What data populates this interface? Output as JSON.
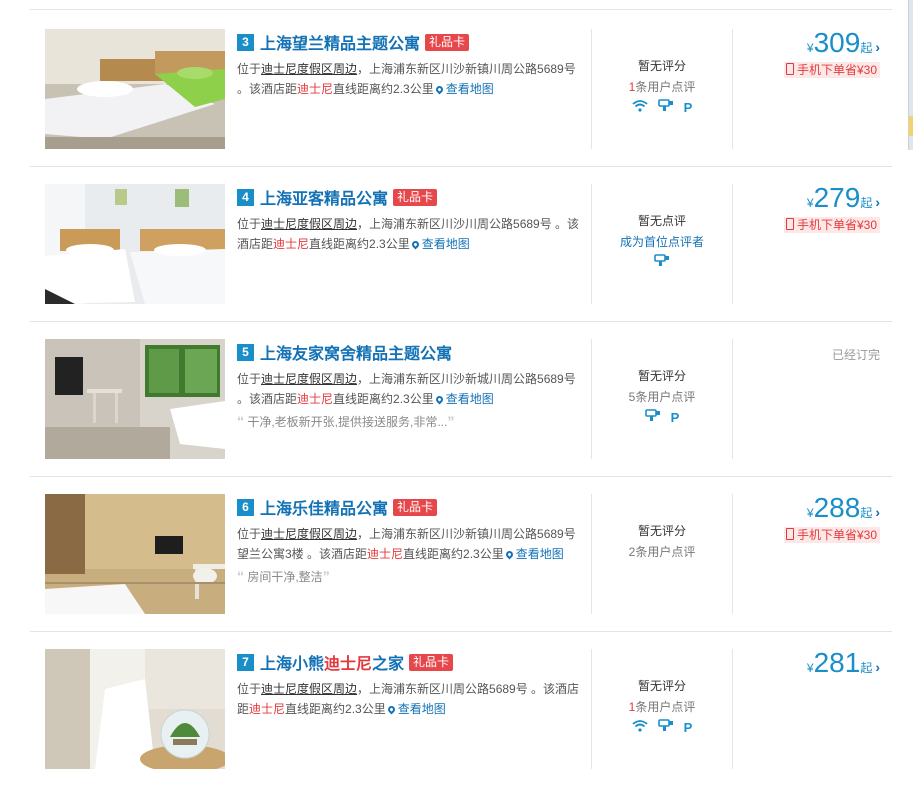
{
  "hotels": [
    {
      "rank": "3",
      "name": "上海望兰精品主题公寓",
      "gift": "礼品卡",
      "addr_pre": "位于",
      "area": "迪士尼度假区周边",
      "addr_mid": "，上海浦东新区川沙新镇川周公路5689号 。该酒店距",
      "landmark": "迪士尼",
      "addr_post": "直线距离约2.3公里",
      "map": "查看地图",
      "score": "暂无评分",
      "count_num": "1",
      "count_text": "条用户点评",
      "price_yen": "¥",
      "price": "309",
      "price_suffix": "起",
      "mobile": "手机下单省¥30",
      "facilities": [
        "wifi-icon",
        "hairdryer-icon",
        "parking-icon"
      ]
    },
    {
      "rank": "4",
      "name": "上海亚客精品公寓",
      "gift": "礼品卡",
      "addr_pre": "位于",
      "area": "迪士尼度假区周边",
      "addr_mid": "，上海浦东新区川沙川周公路5689号 。该酒店距",
      "landmark": "迪士尼",
      "addr_post": "直线距离约2.3公里",
      "map": "查看地图",
      "score": "暂无点评",
      "first_review": "成为首位点评者",
      "price_yen": "¥",
      "price": "279",
      "price_suffix": "起",
      "mobile": "手机下单省¥30",
      "facilities": [
        "hairdryer-icon"
      ]
    },
    {
      "rank": "5",
      "name": "上海友家窝舍精品主题公寓",
      "addr_pre": "位于",
      "area": "迪士尼度假区周边",
      "addr_mid": "，上海浦东新区川沙新城川周公路5689号 。该酒店距",
      "landmark": "迪士尼",
      "addr_post": "直线距离约2.3公里",
      "map": "查看地图",
      "quote": "干净,老板新开张,提供接送服务,非常...",
      "score": "暂无评分",
      "count_num": "5",
      "count_text": "条用户点评",
      "sold_out": "已经订完",
      "facilities": [
        "hairdryer-icon",
        "parking-icon"
      ]
    },
    {
      "rank": "6",
      "name": "上海乐佳精品公寓",
      "gift": "礼品卡",
      "addr_pre": "位于",
      "area": "迪士尼度假区周边",
      "addr_mid": "，上海浦东新区川沙新镇川周公路5689号望兰公寓3楼 。该酒店距",
      "landmark": "迪士尼",
      "addr_post": "直线距离约2.3公里",
      "map": "查看地图",
      "quote": "房间干净,整洁",
      "score": "暂无评分",
      "count_num": "2",
      "count_text": "条用户点评",
      "price_yen": "¥",
      "price": "288",
      "price_suffix": "起",
      "mobile": "手机下单省¥30",
      "facilities": []
    },
    {
      "rank": "7",
      "name_pre": "上海小熊",
      "name_hl": "迪士尼",
      "name_post": "之家",
      "gift": "礼品卡",
      "addr_pre": "位于",
      "area": "迪士尼度假区周边",
      "addr_mid": "，上海浦东新区川周公路5689号 。该酒店距",
      "landmark": "迪士尼",
      "addr_post": "直线距离约2.3公里",
      "map": "查看地图",
      "score": "暂无评分",
      "count_num": "1",
      "count_text": "条用户点评",
      "price_yen": "¥",
      "price": "281",
      "price_suffix": "起",
      "facilities": [
        "wifi-icon",
        "hairdryer-icon",
        "parking-icon"
      ]
    }
  ],
  "colors": {
    "link_blue": "#1372b5",
    "price_blue": "#1a8ec8",
    "accent_red": "#e4393c"
  }
}
